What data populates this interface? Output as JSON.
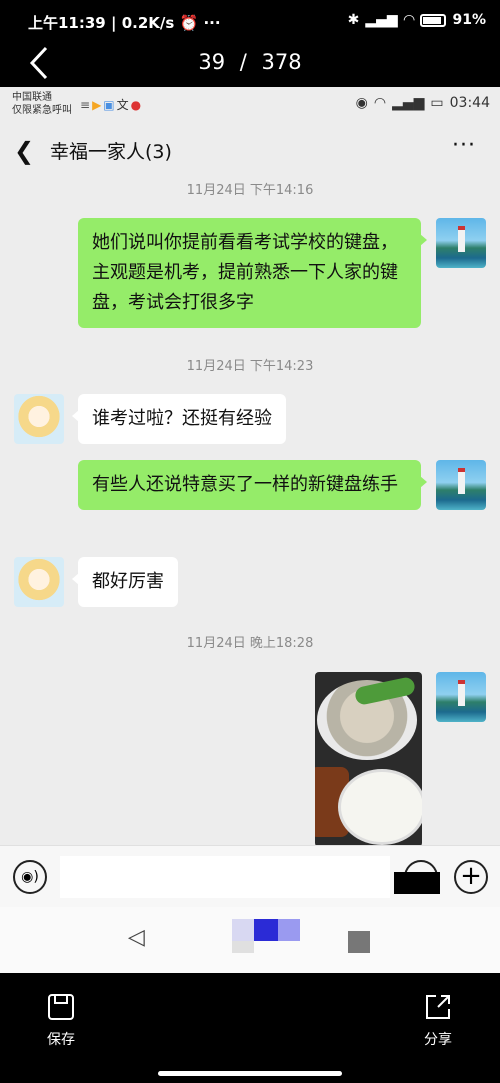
{
  "system_status": {
    "time": "上午11:39",
    "speed": "0.2K/s",
    "battery": "91%"
  },
  "viewer": {
    "current": "39",
    "separator": "/",
    "total": "378"
  },
  "inner_status": {
    "carrier_line1": "中国联通",
    "carrier_line2": "仅限紧急呼叫",
    "time": "03:44"
  },
  "chat": {
    "title": "幸福一家人(3)",
    "more": "···",
    "messages": [
      {
        "type": "timestamp",
        "text": "11月24日 下午14:16"
      },
      {
        "type": "me",
        "text": "她们说叫你提前看看考试学校的键盘，主观题是机考，提前熟悉一下人家的键盘，考试会打很多字"
      },
      {
        "type": "timestamp",
        "text": "11月24日 下午14:23"
      },
      {
        "type": "friend",
        "text": "谁考过啦？还挺有经验"
      },
      {
        "type": "me",
        "text": "有些人还说特意买了一样的新键盘练手"
      },
      {
        "type": "friend",
        "text": "都好厉害"
      },
      {
        "type": "timestamp",
        "text": "11月24日 晚上18:28"
      },
      {
        "type": "me_image",
        "text": ""
      }
    ]
  },
  "toolbar": {
    "save_label": "保存",
    "share_label": "分享"
  },
  "colors": {
    "me_bubble": "#95ec69",
    "friend_bubble": "#ffffff",
    "chat_bg": "#ededed"
  }
}
